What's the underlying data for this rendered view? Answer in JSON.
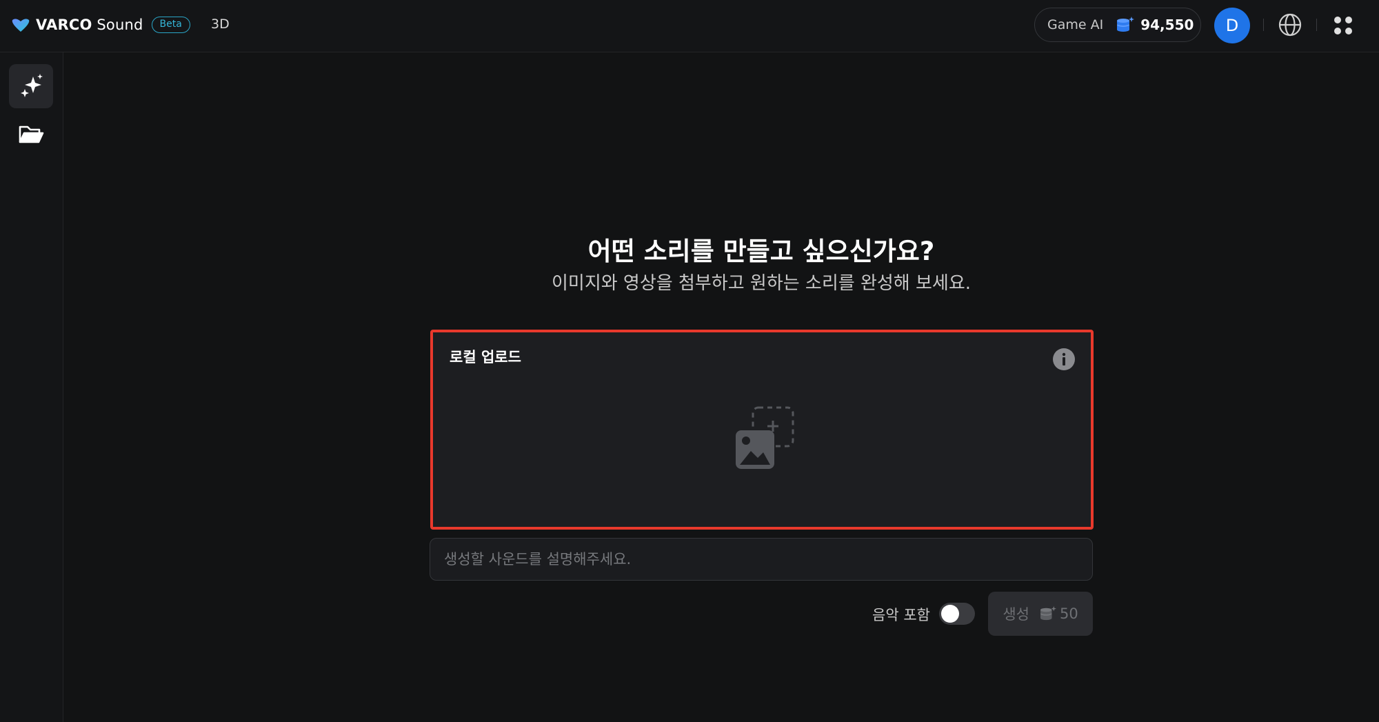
{
  "app": {
    "brand_bold": "VARCO",
    "brand_rest": " Sound",
    "badge": "Beta",
    "nav_3d": "3D",
    "accent": "#1f74e8"
  },
  "header": {
    "credit_label": "Game AI",
    "credit_amount": "94,550",
    "avatar_initial": "D"
  },
  "sidebar": {
    "items": [
      {
        "name": "create",
        "icon": "sparkles-icon",
        "active": true
      },
      {
        "name": "library",
        "icon": "folder-open-icon",
        "active": false
      }
    ]
  },
  "main": {
    "title": "어떤 소리를 만들고 싶으신가요?",
    "subtitle": "이미지와 영상을 첨부하고 원하는 소리를 완성해 보세요.",
    "upload": {
      "title": "로컬 업로드",
      "icon": "add-image-icon"
    },
    "prompt": {
      "placeholder": "생성할 사운드를 설명해주세요.",
      "value": ""
    },
    "music_toggle": {
      "label": "음악 포함",
      "on": false
    },
    "generate": {
      "label": "생성",
      "cost": "50"
    }
  }
}
